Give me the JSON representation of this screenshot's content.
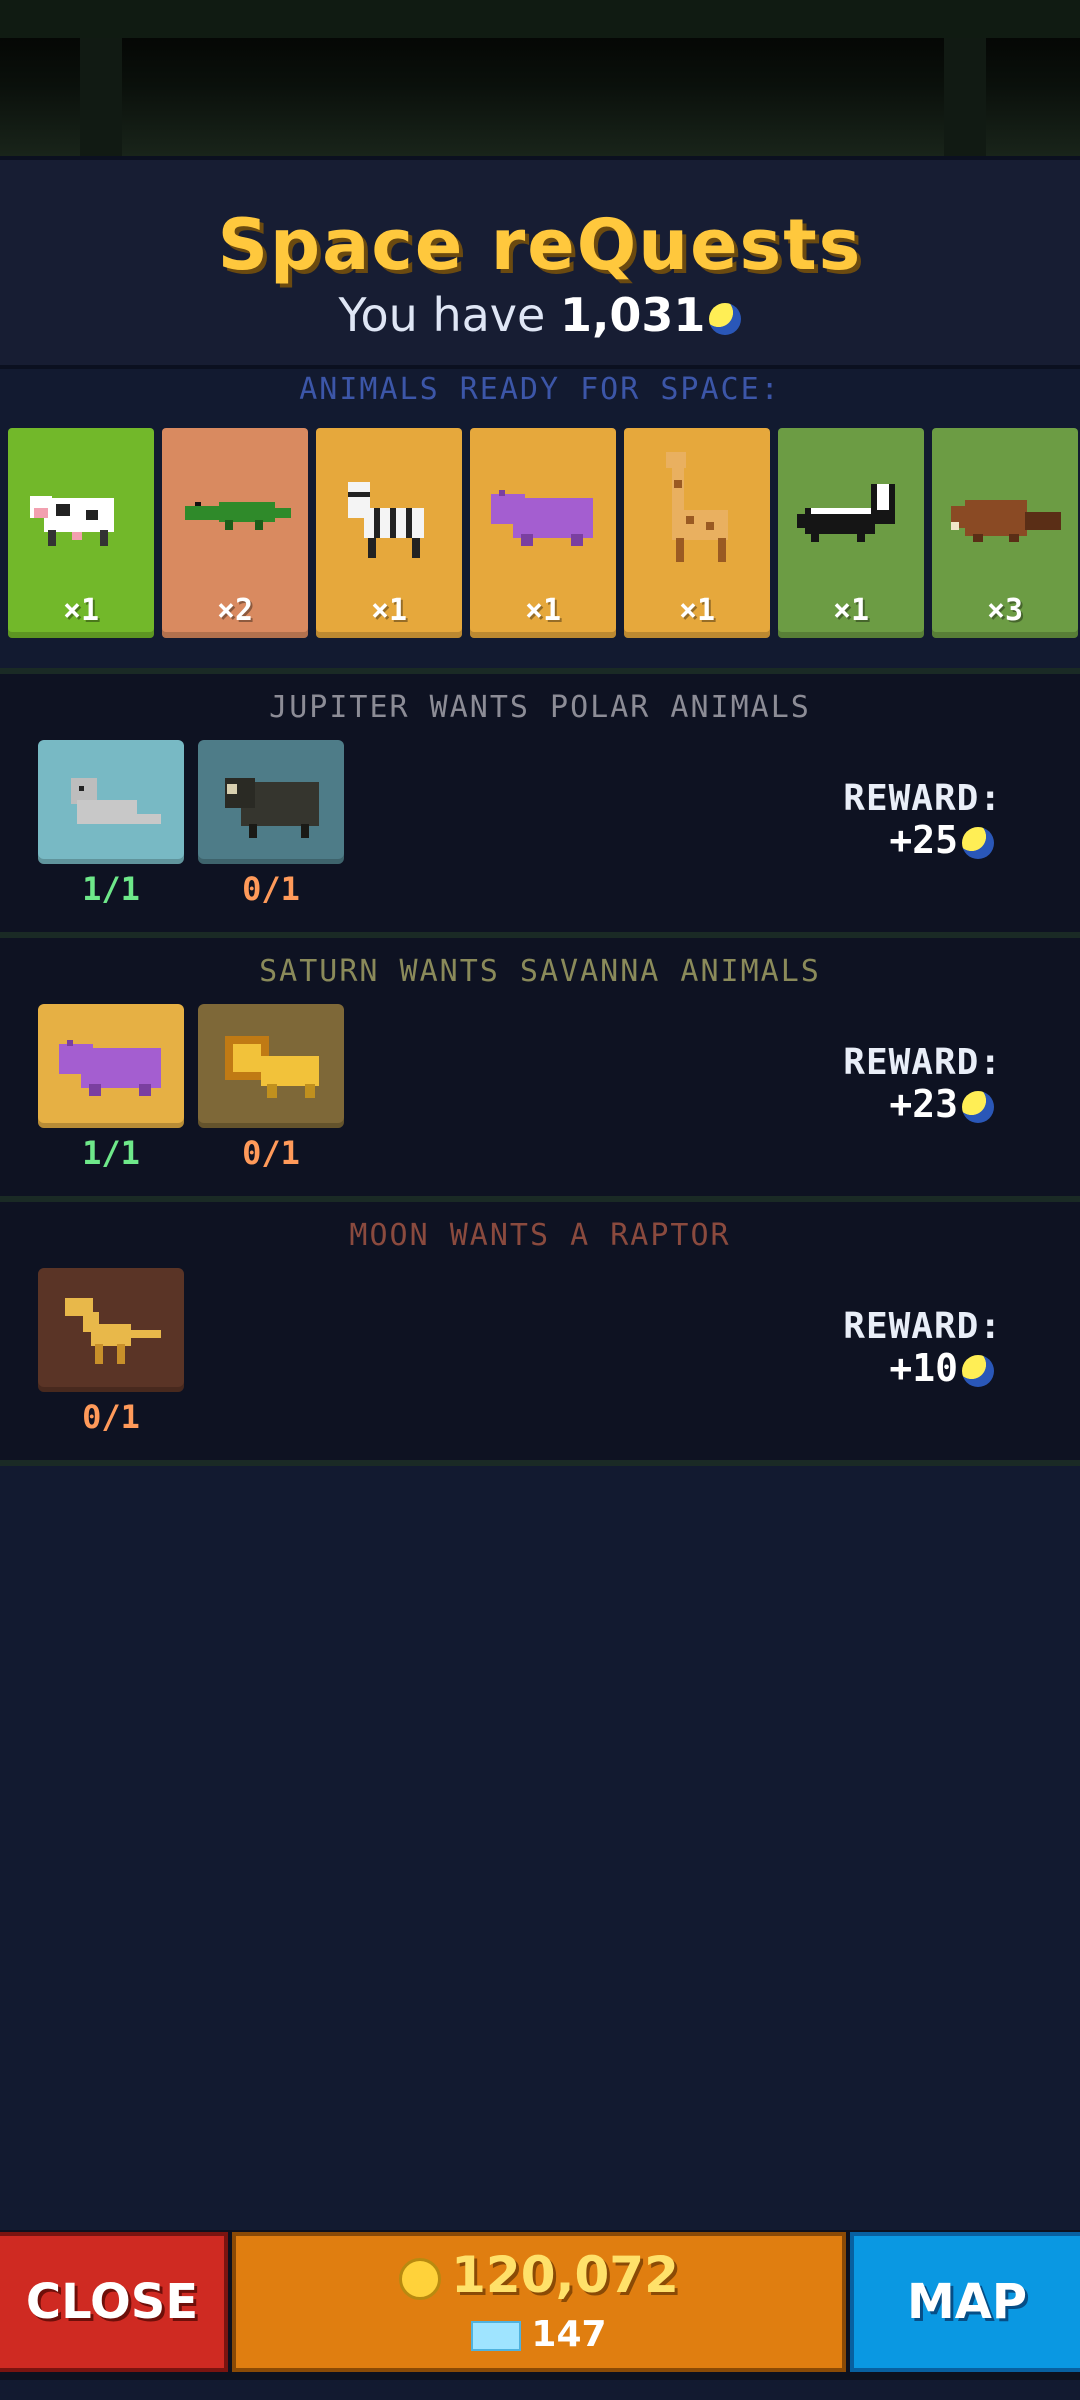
{
  "header": {
    "title": "Space reQuests",
    "balance_prefix": "You have",
    "balance_value": "1,031"
  },
  "ready_label": "ANIMALS READY FOR SPACE:",
  "ready_animals": [
    {
      "animal": "cow",
      "qty": "×1",
      "color": "#72b82a"
    },
    {
      "animal": "crocodile",
      "qty": "×2",
      "color": "#d98a60"
    },
    {
      "animal": "zebra",
      "qty": "×1",
      "color": "#e6a83c"
    },
    {
      "animal": "hippo",
      "qty": "×1",
      "color": "#e6a83c"
    },
    {
      "animal": "giraffe",
      "qty": "×1",
      "color": "#e6a83c"
    },
    {
      "animal": "skunk",
      "qty": "×1",
      "color": "#6c9c44"
    },
    {
      "animal": "beaver",
      "qty": "×3",
      "color": "#6c9c44"
    }
  ],
  "quests": [
    {
      "title": "JUPITER WANTS POLAR ANIMALS",
      "title_color": "#8c8c96",
      "reward_label": "REWARD:",
      "reward_value": "+25",
      "slots": [
        {
          "animal": "seal",
          "progress": "1/1",
          "done": true
        },
        {
          "animal": "musk-ox",
          "progress": "0/1",
          "done": false
        }
      ]
    },
    {
      "title": "SATURN WANTS SAVANNA ANIMALS",
      "title_color": "#8a8a5a",
      "reward_label": "REWARD:",
      "reward_value": "+23",
      "slots": [
        {
          "animal": "hippo",
          "progress": "1/1",
          "done": true
        },
        {
          "animal": "lion",
          "progress": "0/1",
          "done": false
        }
      ]
    },
    {
      "title": "MOON WANTS A RAPTOR",
      "title_color": "#8a4a3e",
      "reward_label": "REWARD:",
      "reward_value": "+10",
      "slots": [
        {
          "animal": "raptor",
          "progress": "0/1",
          "done": false
        }
      ]
    }
  ],
  "footer": {
    "close_label": "CLOSE",
    "coins": "120,072",
    "gems": "147",
    "map_label": "MAP"
  },
  "colors": {
    "done_green": "#6ee88a",
    "pending_orange": "#ff9a5a"
  }
}
